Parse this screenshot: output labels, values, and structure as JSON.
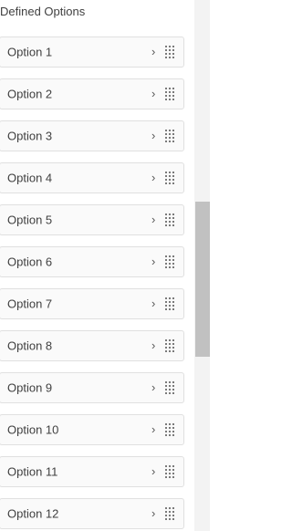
{
  "section": {
    "title": "Defined Options"
  },
  "options": [
    {
      "label": "Option 1",
      "chevron": "›"
    },
    {
      "label": "Option 2",
      "chevron": "›"
    },
    {
      "label": "Option 3",
      "chevron": "›"
    },
    {
      "label": "Option 4",
      "chevron": "›"
    },
    {
      "label": "Option 5",
      "chevron": "›"
    },
    {
      "label": "Option 6",
      "chevron": "›"
    },
    {
      "label": "Option 7",
      "chevron": "›"
    },
    {
      "label": "Option 8",
      "chevron": "›"
    },
    {
      "label": "Option 9",
      "chevron": "›"
    },
    {
      "label": "Option 10",
      "chevron": "›"
    },
    {
      "label": "Option 11",
      "chevron": "›"
    },
    {
      "label": "Option 12",
      "chevron": "›"
    }
  ],
  "icons": {
    "chevron": "chevron-right-icon",
    "drag": "drag-handle-icon"
  },
  "colors": {
    "item_background": "#fafafa",
    "item_border": "#e0e0e0",
    "text": "#404040",
    "scroll_thumb": "#c1c1c1"
  }
}
